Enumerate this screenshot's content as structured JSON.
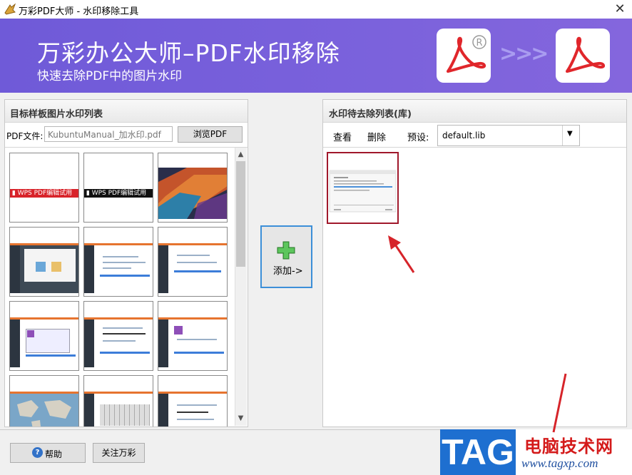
{
  "window": {
    "title": "万彩PDF大师 - 水印移除工具",
    "close": "✕"
  },
  "banner": {
    "title": "万彩办公大师–PDF水印移除",
    "subtitle": "快速去除PDF中的图片水印",
    "arrows": ">>>",
    "registered": "®"
  },
  "left_panel": {
    "header": "目标样板图片水印列表",
    "pdf_file_label": "PDF文件:",
    "pdf_path_value": "KubuntuManual_加水印.pdf",
    "browse_label": "浏览PDF",
    "thumbnails": [
      {
        "kind": "wps",
        "text": "WPS PDF编辑试用",
        "color": "#d8232a"
      },
      {
        "kind": "wps",
        "text": "WPS PDF编辑试用",
        "color": "#111111"
      },
      {
        "kind": "wallpaper"
      },
      {
        "kind": "screenshot"
      },
      {
        "kind": "screenshot"
      },
      {
        "kind": "screenshot"
      },
      {
        "kind": "screenshot"
      },
      {
        "kind": "screenshot"
      },
      {
        "kind": "screenshot"
      },
      {
        "kind": "map"
      },
      {
        "kind": "screenshot"
      },
      {
        "kind": "screenshot"
      }
    ]
  },
  "add_button": {
    "label": "添加->"
  },
  "right_panel": {
    "header": "水印待去除列表(库)",
    "view_label": "查看",
    "delete_label": "删除",
    "preset_label": "预设:",
    "preset_value": "default.lib"
  },
  "footer": {
    "help_label": "帮助",
    "follow_label": "关注万彩"
  },
  "watermark": {
    "logo": "TAG",
    "cn_text": "电脑技术网",
    "url": "www.tagxp.com"
  },
  "colors": {
    "banner": "#7560da",
    "accent_blue": "#3c8fd8",
    "selection_red": "#a0182b",
    "annotation_red": "#d6242a"
  }
}
